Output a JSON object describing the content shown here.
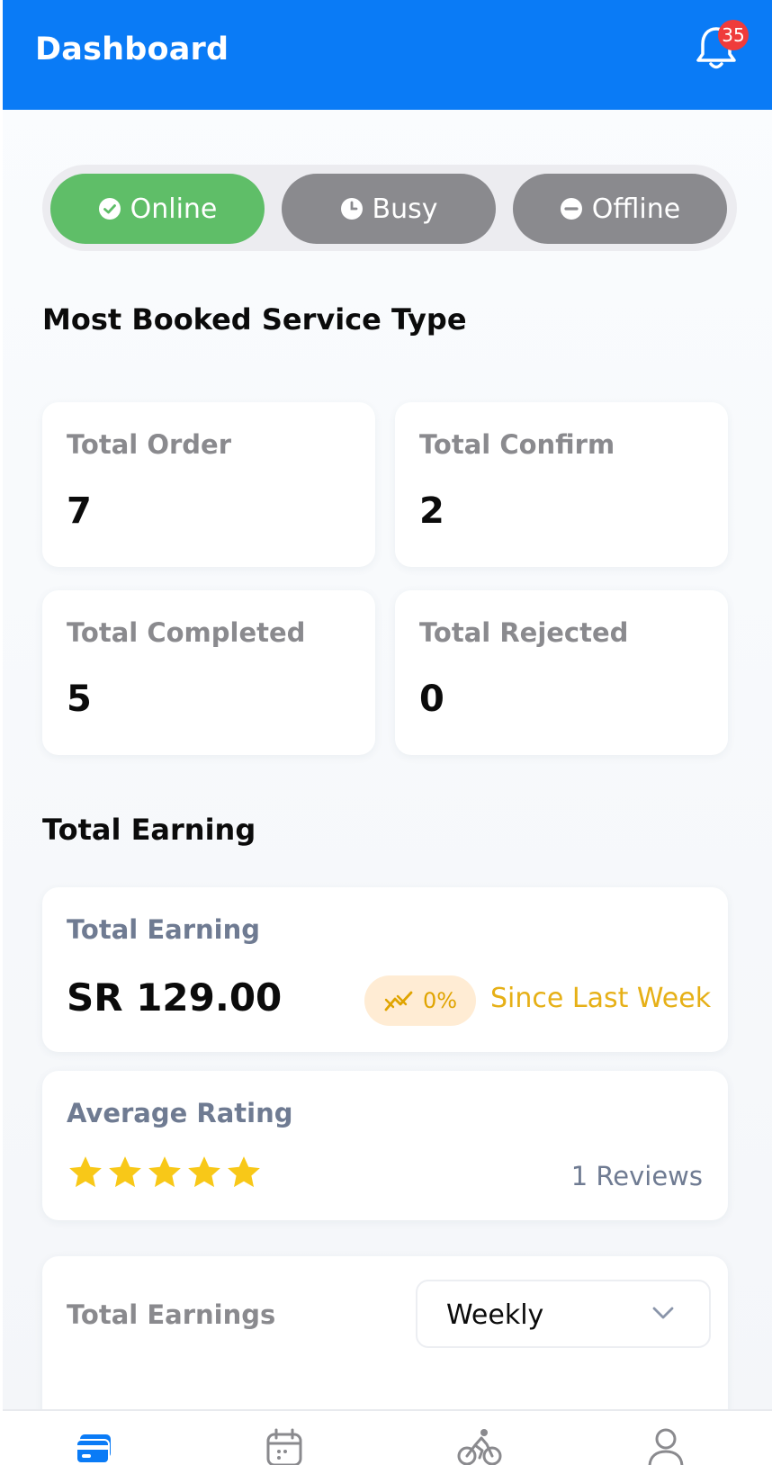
{
  "header": {
    "title": "Dashboard",
    "notification_count": "35",
    "icon": "bell-icon",
    "background": "#0a7bf6"
  },
  "status": {
    "online_label": "Online",
    "busy_label": "Busy",
    "offline_label": "Offline",
    "active": "online",
    "colors": {
      "active": "#5fbe68",
      "inactive": "#8a8a8e"
    }
  },
  "service": {
    "title": "Most Booked Service Type",
    "cards": [
      {
        "label": "Total Order",
        "value": "7"
      },
      {
        "label": "Total Confirm",
        "value": "2"
      },
      {
        "label": "Total Completed",
        "value": "5"
      },
      {
        "label": "Total Rejected",
        "value": "0"
      }
    ]
  },
  "earning": {
    "section_title": "Total Earning",
    "label": "Total Earning",
    "amount": "SR 129.00",
    "change": "0%",
    "change_icon": "trend-icon",
    "since": "Since Last Week"
  },
  "rating": {
    "label": "Average Rating",
    "stars": 5,
    "reviews": "1 Reviews",
    "star_color": "#f8c818"
  },
  "earnings_chart": {
    "label": "Total Earnings",
    "period_selected": "Weekly"
  },
  "bottom_nav": {
    "items": [
      {
        "icon": "wallet-icon",
        "active": true
      },
      {
        "icon": "calendar-icon",
        "active": false
      },
      {
        "icon": "bicycle-icon",
        "active": false
      },
      {
        "icon": "profile-icon",
        "active": false
      }
    ]
  }
}
